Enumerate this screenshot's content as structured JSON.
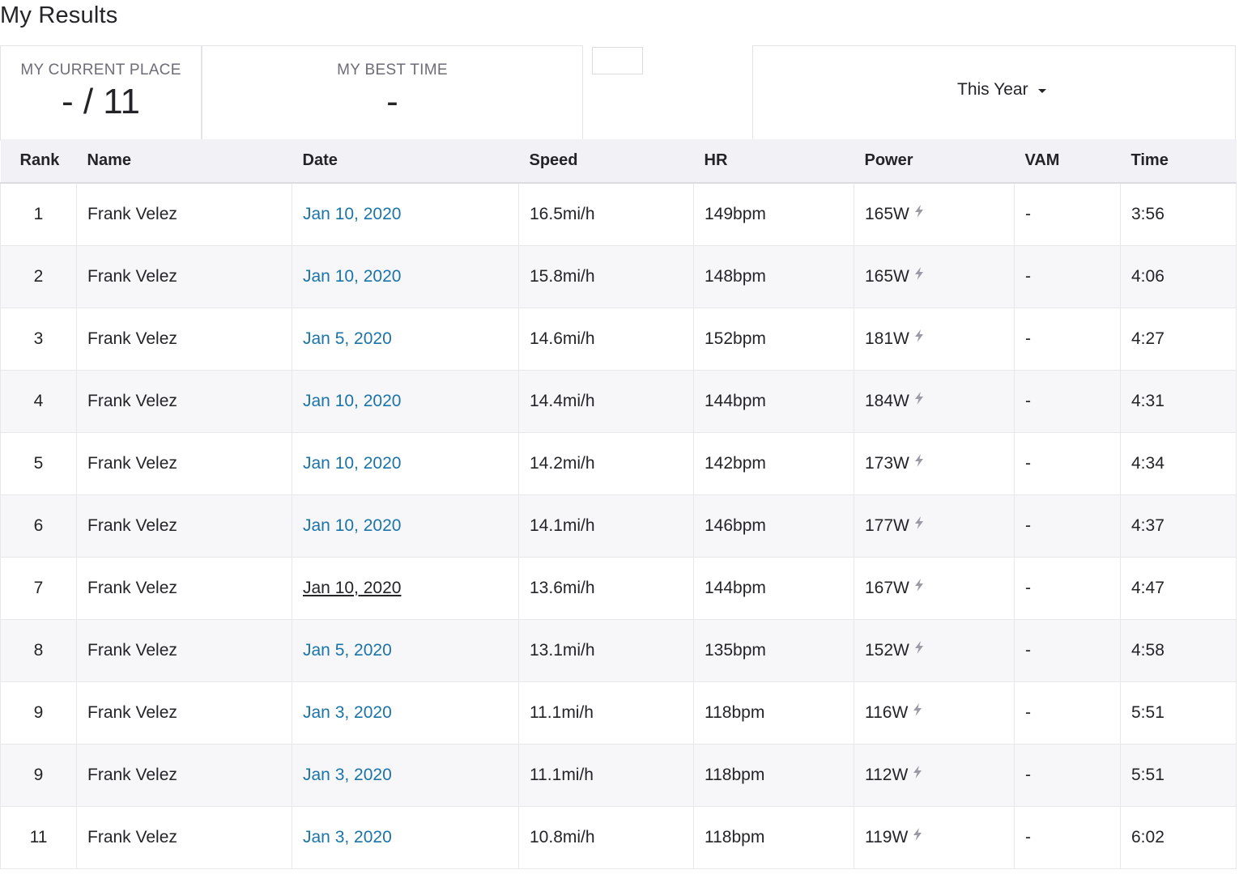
{
  "page": {
    "title": "My Results"
  },
  "summary": {
    "current_place_label": "MY CURRENT PLACE",
    "current_place_value": "- / 11",
    "best_time_label": "MY BEST TIME",
    "best_time_value": "-",
    "filter_label": "This Year"
  },
  "colors": {
    "link": "#1b74a8",
    "header_bg": "#f2f2f6",
    "stripe_bg": "#f7f7fa"
  },
  "table": {
    "headers": [
      "Rank",
      "Name",
      "Date",
      "Speed",
      "HR",
      "Power",
      "VAM",
      "Time"
    ],
    "rows": [
      {
        "rank": "1",
        "name": "Frank Velez",
        "date": "Jan 10, 2020",
        "speed": "16.5mi/h",
        "hr": "149bpm",
        "power": "165W",
        "power_icon": "lightning-bolt-icon",
        "vam": "-",
        "time": "3:56"
      },
      {
        "rank": "2",
        "name": "Frank Velez",
        "date": "Jan 10, 2020",
        "speed": "15.8mi/h",
        "hr": "148bpm",
        "power": "165W",
        "power_icon": "lightning-bolt-icon",
        "vam": "-",
        "time": "4:06"
      },
      {
        "rank": "3",
        "name": "Frank Velez",
        "date": "Jan 5, 2020",
        "speed": "14.6mi/h",
        "hr": "152bpm",
        "power": "181W",
        "power_icon": "lightning-bolt-icon",
        "vam": "-",
        "time": "4:27"
      },
      {
        "rank": "4",
        "name": "Frank Velez",
        "date": "Jan 10, 2020",
        "speed": "14.4mi/h",
        "hr": "144bpm",
        "power": "184W",
        "power_icon": "lightning-bolt-icon",
        "vam": "-",
        "time": "4:31"
      },
      {
        "rank": "5",
        "name": "Frank Velez",
        "date": "Jan 10, 2020",
        "speed": "14.2mi/h",
        "hr": "142bpm",
        "power": "173W",
        "power_icon": "lightning-bolt-icon",
        "vam": "-",
        "time": "4:34"
      },
      {
        "rank": "6",
        "name": "Frank Velez",
        "date": "Jan 10, 2020",
        "speed": "14.1mi/h",
        "hr": "146bpm",
        "power": "177W",
        "power_icon": "lightning-bolt-icon",
        "vam": "-",
        "time": "4:37"
      },
      {
        "rank": "7",
        "name": "Frank Velez",
        "date": "Jan 10, 2020",
        "speed": "13.6mi/h",
        "hr": "144bpm",
        "power": "167W",
        "power_icon": "lightning-bolt-icon",
        "vam": "-",
        "time": "4:47",
        "date_hovered": true
      },
      {
        "rank": "8",
        "name": "Frank Velez",
        "date": "Jan 5, 2020",
        "speed": "13.1mi/h",
        "hr": "135bpm",
        "power": "152W",
        "power_icon": "lightning-bolt-icon",
        "vam": "-",
        "time": "4:58"
      },
      {
        "rank": "9",
        "name": "Frank Velez",
        "date": "Jan 3, 2020",
        "speed": "11.1mi/h",
        "hr": "118bpm",
        "power": "116W",
        "power_icon": "lightning-bolt-icon",
        "vam": "-",
        "time": "5:51"
      },
      {
        "rank": "9",
        "name": "Frank Velez",
        "date": "Jan 3, 2020",
        "speed": "11.1mi/h",
        "hr": "118bpm",
        "power": "112W",
        "power_icon": "lightning-bolt-icon",
        "vam": "-",
        "time": "5:51"
      },
      {
        "rank": "11",
        "name": "Frank Velez",
        "date": "Jan 3, 2020",
        "speed": "10.8mi/h",
        "hr": "118bpm",
        "power": "119W",
        "power_icon": "lightning-bolt-icon",
        "vam": "-",
        "time": "6:02"
      }
    ]
  }
}
